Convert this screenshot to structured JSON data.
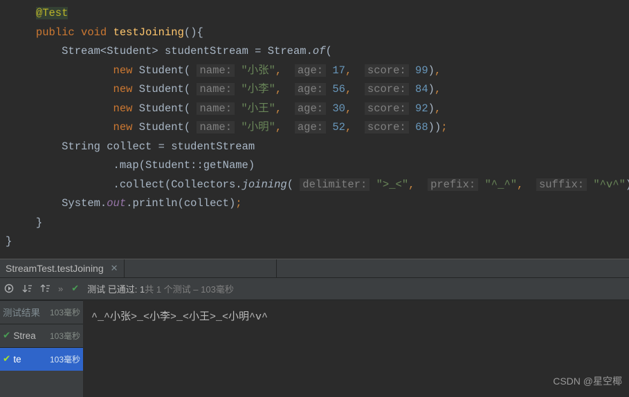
{
  "code": {
    "annotation": "@Test",
    "kw_public": "public",
    "kw_void": "void",
    "method_name": "testJoining",
    "stream_decl_1": "Stream<Student> studentStream = Stream.",
    "of": "of",
    "kw_new": "new",
    "student_ctor": "Student(",
    "param_name": "name:",
    "param_age": "age:",
    "param_score": "score:",
    "students": [
      {
        "name": "\"小张\"",
        "age": "17",
        "score": "99"
      },
      {
        "name": "\"小李\"",
        "age": "56",
        "score": "84"
      },
      {
        "name": "\"小王\"",
        "age": "30",
        "score": "92"
      },
      {
        "name": "\"小明\"",
        "age": "52",
        "score": "68"
      }
    ],
    "string_collect": "String collect = studentStream",
    "map_call": ".map(Student::getName)",
    "collect_pre": ".collect(Collectors.",
    "joining": "joining",
    "param_delim": "delimiter:",
    "delim_val": "\">_<\"",
    "param_prefix": "prefix:",
    "prefix_val": "\"^_^\"",
    "param_suffix": "suffix:",
    "suffix_val": "\"^v^\"",
    "sysout_pre": "System.",
    "out": "out",
    "sysout_post": ".println(collect)"
  },
  "tab": {
    "label": "StreamTest.testJoining"
  },
  "status": {
    "pass_prefix": "测试 已通过: 1",
    "pass_mid": "共 1 个测试",
    "pass_suffix": " – 103毫秒"
  },
  "tree": {
    "header": "测试结果",
    "header_time": "103毫秒",
    "rows": [
      {
        "label": "Strea",
        "time": "103毫秒"
      },
      {
        "label": "te",
        "time": "103毫秒"
      }
    ]
  },
  "output": "^_^小张>_<小李>_<小王>_<小明^v^",
  "watermark": "CSDN @星空椰"
}
